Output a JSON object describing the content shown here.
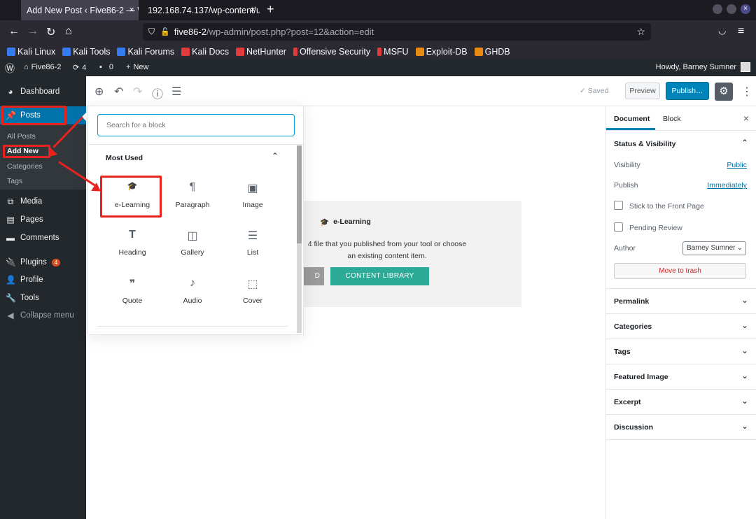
{
  "browser": {
    "tabs": [
      {
        "label": "Add New Post ‹ Five86-2 — W",
        "close": "×"
      },
      {
        "label": "192.168.74.137/wp-content/u",
        "close": "×"
      }
    ],
    "new_tab": "+",
    "url_host": "five86-2",
    "url_path": "/wp-admin/post.php?post=12&action=edit",
    "bookmarks": [
      {
        "label": "Kali Linux",
        "color": "#367bf0"
      },
      {
        "label": "Kali Tools",
        "color": "#367bf0"
      },
      {
        "label": "Kali Forums",
        "color": "#367bf0"
      },
      {
        "label": "Kali Docs",
        "color": "#e23b3b"
      },
      {
        "label": "NetHunter",
        "color": "#e23b3b"
      },
      {
        "label": "Offensive Security",
        "color": "#e23b3b"
      },
      {
        "label": "MSFU",
        "color": "#e23b3b"
      },
      {
        "label": "Exploit-DB",
        "color": "#e98a15"
      },
      {
        "label": "GHDB",
        "color": "#e98a15"
      }
    ]
  },
  "adminbar": {
    "site": "Five86-2",
    "updates": "4",
    "comments": "0",
    "new": "New",
    "howdy": "Howdy, Barney Sumner"
  },
  "sidebar": {
    "dashboard": "Dashboard",
    "posts": "Posts",
    "sub": [
      "All Posts",
      "Add New",
      "Categories",
      "Tags"
    ],
    "media": "Media",
    "pages": "Pages",
    "comments": "Comments",
    "plugins": "Plugins",
    "plugins_badge": "4",
    "profile": "Profile",
    "tools": "Tools",
    "collapse": "Collapse menu"
  },
  "toolbar": {
    "saved": "Saved",
    "preview": "Preview",
    "publish": "Publish…"
  },
  "inserter": {
    "search_placeholder": "Search for a block",
    "section": "Most Used",
    "blocks": [
      {
        "label": "e-Learning",
        "icon": "graduation-cap-icon",
        "glyph": "🎓"
      },
      {
        "label": "Paragraph",
        "icon": "paragraph-icon",
        "glyph": "¶"
      },
      {
        "label": "Image",
        "icon": "image-icon",
        "glyph": "▣"
      },
      {
        "label": "Heading",
        "icon": "heading-icon",
        "glyph": "T"
      },
      {
        "label": "Gallery",
        "icon": "gallery-icon",
        "glyph": "◫"
      },
      {
        "label": "List",
        "icon": "list-icon",
        "glyph": "☰"
      },
      {
        "label": "Quote",
        "icon": "quote-icon",
        "glyph": "❞"
      },
      {
        "label": "Audio",
        "icon": "audio-icon",
        "glyph": "♪"
      },
      {
        "label": "Cover",
        "icon": "cover-icon",
        "glyph": "⬚"
      }
    ]
  },
  "elearning_block": {
    "title": "e-Learning",
    "text_line1": "4 file that you published from your tool or choose",
    "text_line2": "an existing content item.",
    "grey_button": "D",
    "library_button": "CONTENT LIBRARY"
  },
  "settings_sidebar": {
    "tab_document": "Document",
    "tab_block": "Block",
    "status_title": "Status & Visibility",
    "visibility_label": "Visibility",
    "visibility_value": "Public",
    "publish_label": "Publish",
    "publish_value": "Immediately",
    "sticky_label": "Stick to the Front Page",
    "pending_label": "Pending Review",
    "author_label": "Author",
    "author_value": "Barney Sumner",
    "trash": "Move to trash",
    "sections": [
      "Permalink",
      "Categories",
      "Tags",
      "Featured Image",
      "Excerpt",
      "Discussion"
    ]
  },
  "colors": {
    "wp_blue": "#0073aa",
    "publish_blue": "#0085ba",
    "annotation_red": "#e8231e",
    "library_teal": "#2bab97"
  }
}
